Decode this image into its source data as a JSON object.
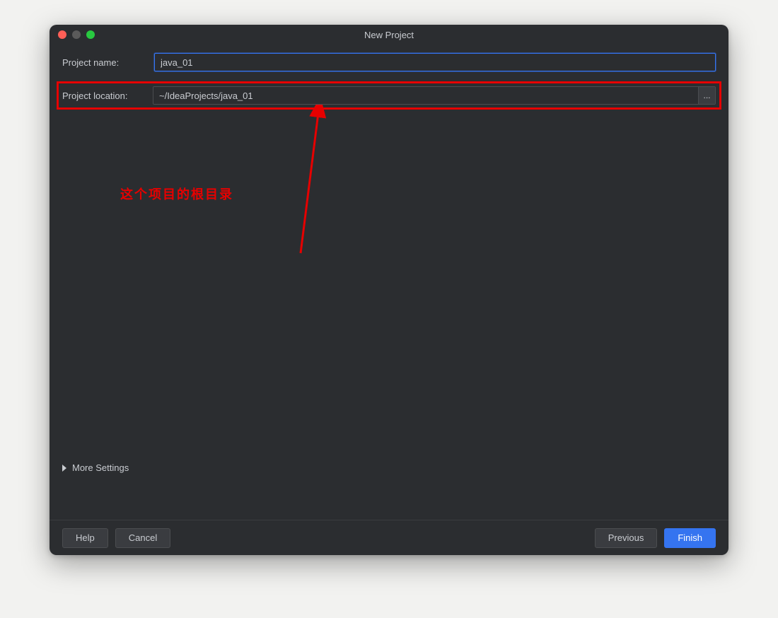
{
  "window": {
    "title": "New Project"
  },
  "form": {
    "name_label": "Project name:",
    "name_value": "java_01",
    "location_label": "Project location:",
    "location_value": "~/IdeaProjects/java_01",
    "browse_label": "..."
  },
  "annotation": {
    "text": "这个项目的根目录"
  },
  "more_settings_label": "More Settings",
  "buttons": {
    "help": "Help",
    "cancel": "Cancel",
    "previous": "Previous",
    "finish": "Finish"
  }
}
